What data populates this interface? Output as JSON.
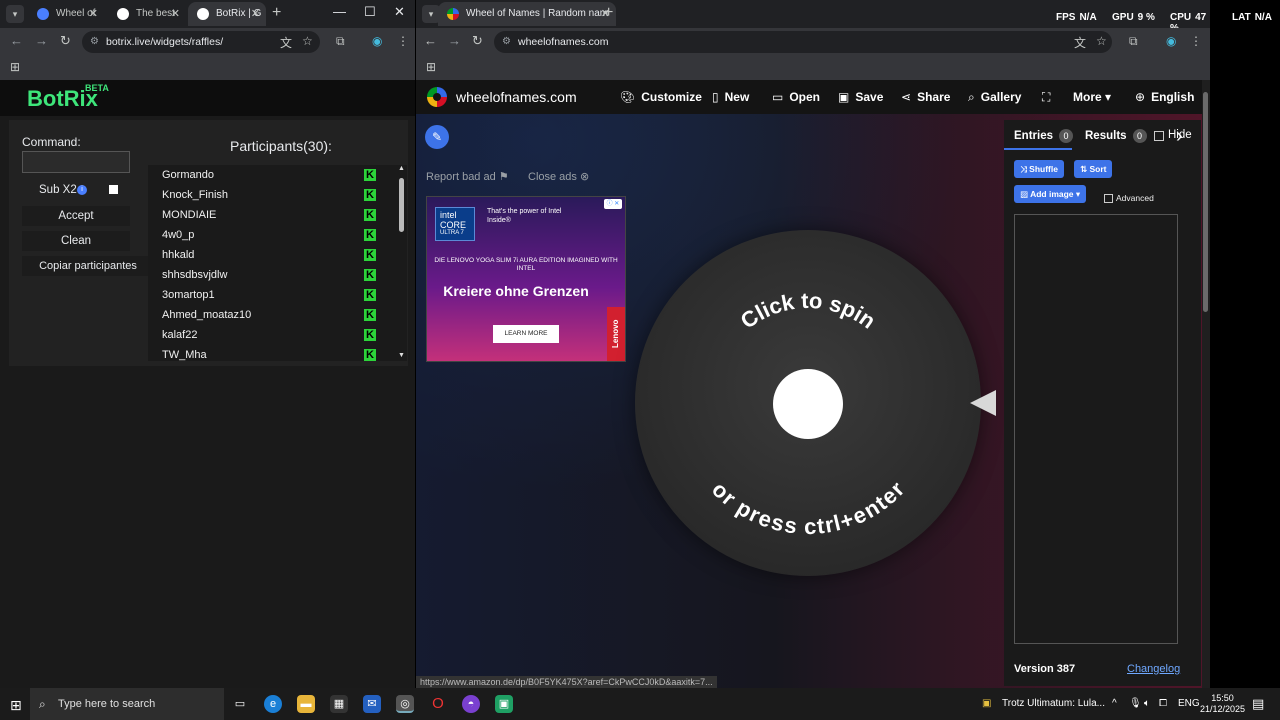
{
  "left_window": {
    "tabs": [
      {
        "label": "Wheel of",
        "color": "#4a7fff"
      },
      {
        "label": "The best",
        "color": "#ffffff"
      },
      {
        "label": "BotRix | G",
        "color": "#ffffff"
      }
    ],
    "url": "botrix.live/widgets/raffles/",
    "botrix": {
      "logo": "BotRix",
      "beta": "BETA",
      "command_label": "Command:",
      "command_value": "",
      "sub_label": "Sub X2",
      "accept": "Accept",
      "clean": "Clean",
      "copy": "Copiar participantes",
      "participants_title": "Participants(30):",
      "participants": [
        "Gormando",
        "Knock_Finish",
        "MONDIAIE",
        "4w0_p",
        "hhkald",
        "shhsdbsvjdlw",
        "3omartop1",
        "Ahmed_moataz10",
        "kalaf22",
        "TW_Mha"
      ],
      "kick_icon": "K"
    }
  },
  "right_window": {
    "tab": "Wheel of Names | Random nam",
    "url": "wheelofnames.com",
    "site_title": "wheelofnames.com",
    "nav": {
      "customize": "Customize",
      "new": "New",
      "open": "Open",
      "save": "Save",
      "share": "Share",
      "gallery": "Gallery",
      "more": "More",
      "language": "English"
    },
    "report_ad": "Report bad ad",
    "close_ads": "Close ads",
    "ad": {
      "intel": "intel CORE",
      "intel_sub": "ULTRA 7",
      "power": "That's the power of Intel Inside®",
      "edition": "DIE LENOVO YOGA SLIM 7i AURA EDITION IMAGINED WITH INTEL",
      "headline": "Kreiere ohne Grenzen",
      "cta": "LEARN MORE",
      "brand": "Lenovo"
    },
    "wheel": {
      "top_text": "Click to spin",
      "bottom_text": "or press ctrl+enter"
    },
    "sidebar": {
      "entries": "Entries",
      "entries_count": "0",
      "results": "Results",
      "results_count": "0",
      "hide": "Hide",
      "shuffle": "Shuffle",
      "sort": "Sort",
      "add_image": "Add image",
      "advanced": "Advanced",
      "version": "Version 387",
      "changelog": "Changelog"
    },
    "status_url": "https://www.amazon.de/dp/B0F5YK475X?aref=CkPwCCJ0kD&aaxitk=7..."
  },
  "stats": {
    "fps_label": "FPS",
    "fps": "N/A",
    "gpu_label": "GPU",
    "gpu": "9 %",
    "cpu_label": "CPU",
    "cpu": "47 %",
    "lat_label": "LAT",
    "lat": "N/A"
  },
  "taskbar": {
    "search_placeholder": "Type here to search",
    "media": "Trotz Ultimatum: Lula...",
    "lang": "ENG",
    "time": "15:50",
    "date": "21/12/2025"
  }
}
